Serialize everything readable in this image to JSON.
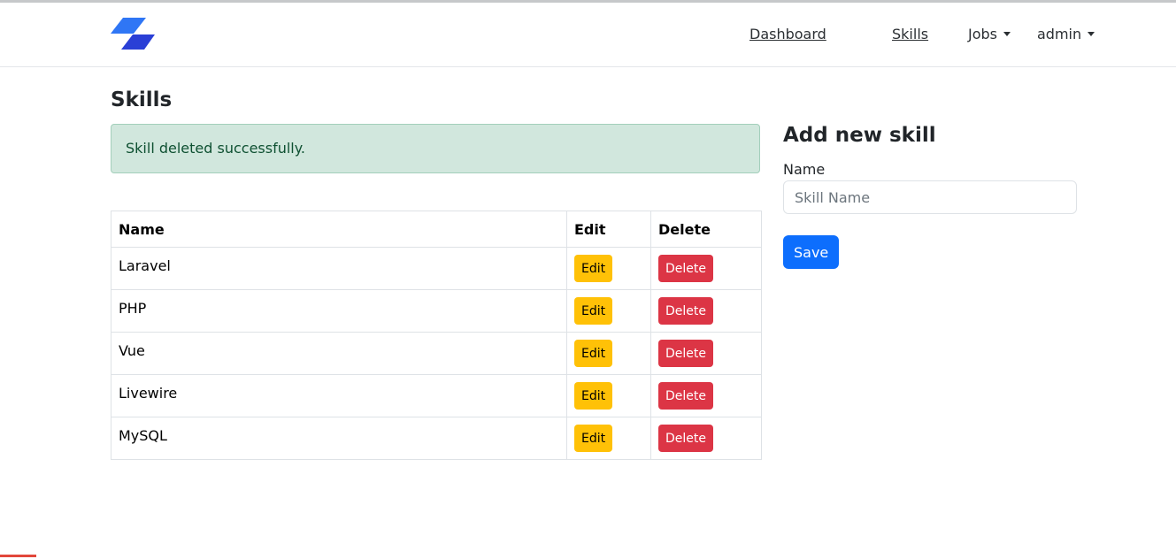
{
  "navbar": {
    "logo_icon": "brand-logo-icon",
    "links": [
      {
        "label": "Dashboard"
      },
      {
        "label": "Skills"
      }
    ],
    "dropdowns": [
      {
        "label": "Jobs"
      },
      {
        "label": "admin"
      }
    ]
  },
  "page": {
    "title": "Skills"
  },
  "alert": {
    "message": "Skill deleted successfully."
  },
  "table": {
    "headers": [
      "Name",
      "Edit",
      "Delete"
    ],
    "rows": [
      {
        "name": "Laravel",
        "edit_label": "Edit",
        "delete_label": "Delete"
      },
      {
        "name": "PHP",
        "edit_label": "Edit",
        "delete_label": "Delete"
      },
      {
        "name": "Vue",
        "edit_label": "Edit",
        "delete_label": "Delete"
      },
      {
        "name": "Livewire",
        "edit_label": "Edit",
        "delete_label": "Delete"
      },
      {
        "name": "MySQL",
        "edit_label": "Edit",
        "delete_label": "Delete"
      }
    ]
  },
  "form": {
    "title": "Add new skill",
    "name_label": "Name",
    "name_placeholder": "Skill Name",
    "name_value": "",
    "save_label": "Save"
  },
  "colors": {
    "primary": "#0d6efd",
    "warning": "#ffc107",
    "danger": "#dc3545",
    "success_bg": "#d1e7dd",
    "logo_light": "#2f76f5",
    "logo_dark": "#2a3fd6"
  }
}
